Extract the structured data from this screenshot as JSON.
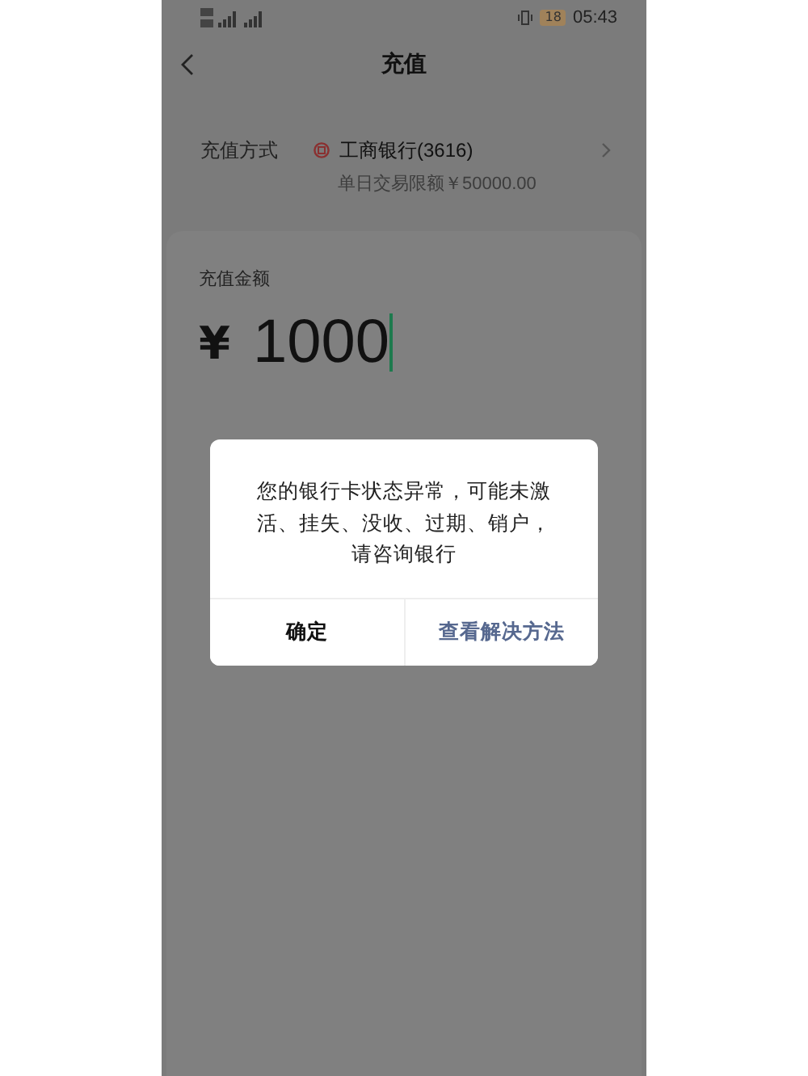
{
  "status_bar": {
    "battery": "18",
    "time": "05:43"
  },
  "header": {
    "title": "充值"
  },
  "payment": {
    "label": "充值方式",
    "bank": "工商银行(3616)",
    "limit": "单日交易限额￥50000.00"
  },
  "amount": {
    "label": "充值金额",
    "currency": "¥",
    "value": "1000"
  },
  "dialog": {
    "message": "您的银行卡状态异常，可能未激活、挂失、没收、过期、销户，请咨询银行",
    "buttons": [
      {
        "label": "确定",
        "kind": "plain"
      },
      {
        "label": "查看解决方法",
        "kind": "link"
      }
    ]
  }
}
